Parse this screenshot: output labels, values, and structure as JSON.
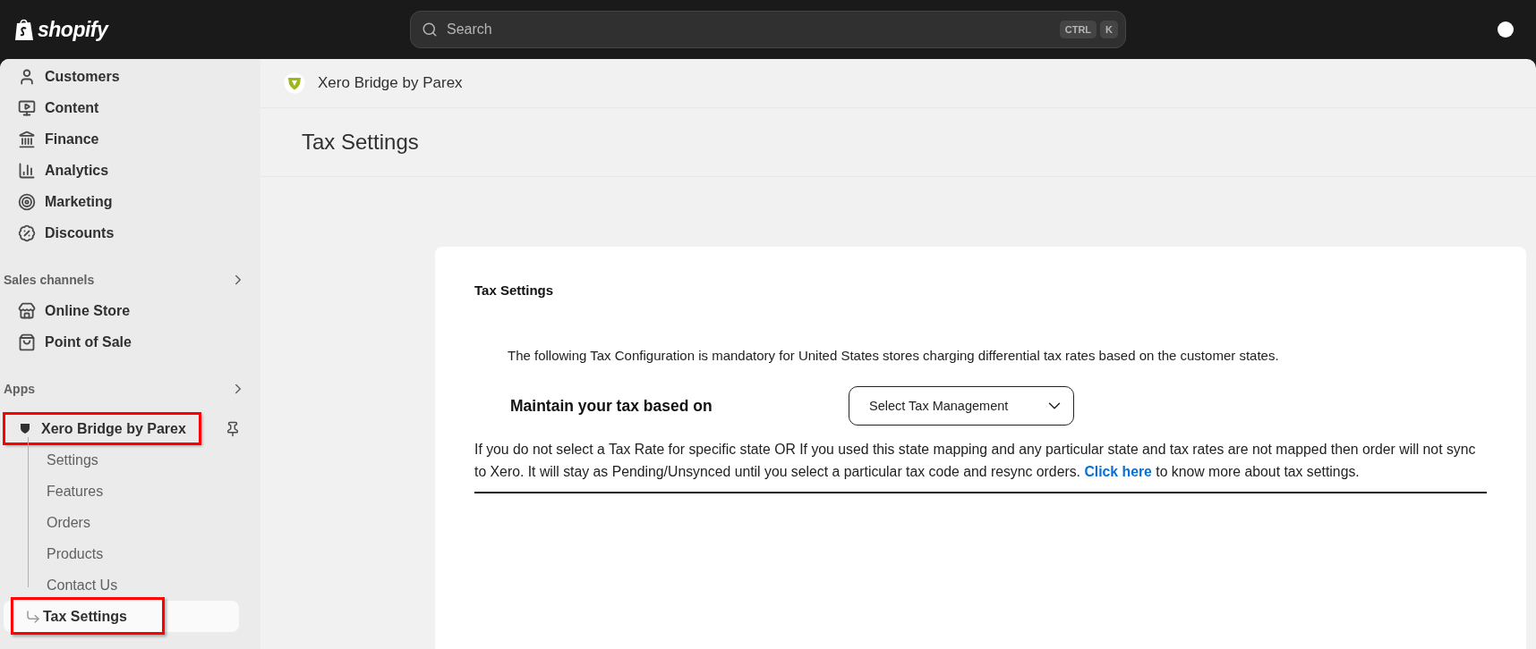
{
  "topbar": {
    "brand": "shopify",
    "search": {
      "placeholder": "Search",
      "keys": [
        "CTRL",
        "K"
      ]
    }
  },
  "sidebar": {
    "main_items": [
      {
        "label": "Customers",
        "kind": "user"
      },
      {
        "label": "Content",
        "kind": "content"
      },
      {
        "label": "Finance",
        "kind": "bank"
      },
      {
        "label": "Analytics",
        "kind": "chart"
      },
      {
        "label": "Marketing",
        "kind": "target"
      },
      {
        "label": "Discounts",
        "kind": "discount"
      }
    ],
    "sections": [
      {
        "title": "Sales channels",
        "items": [
          {
            "label": "Online Store",
            "kind": "store"
          },
          {
            "label": "Point of Sale",
            "kind": "bag"
          }
        ]
      },
      {
        "title": "Apps"
      }
    ],
    "app": {
      "label": "Xero Bridge by Parex",
      "highlighted": true,
      "pinned": false,
      "children": [
        {
          "label": "Settings",
          "selected": false,
          "highlighted": false
        },
        {
          "label": "Features",
          "selected": false,
          "highlighted": false
        },
        {
          "label": "Orders",
          "selected": false,
          "highlighted": false
        },
        {
          "label": "Products",
          "selected": false,
          "highlighted": false
        },
        {
          "label": "Contact Us",
          "selected": false,
          "highlighted": false
        },
        {
          "label": "Tax Settings",
          "selected": true,
          "highlighted": true
        }
      ]
    }
  },
  "app_header": {
    "title": "Xero Bridge by Parex"
  },
  "page_title": "Tax Settings",
  "card": {
    "title": "Tax Settings",
    "intro": "The following Tax Configuration is mandatory for United States stores charging differential tax rates based on the customer states.",
    "field_label": "Maintain your tax based on",
    "select_value": "Select Tax Management",
    "note": {
      "before": "If you do not select a Tax Rate for specific state OR If you used this state mapping and any particular state and tax rates are not mapped then order will not sync to Xero. It will stay as Pending/Unsynced until you select a particular tax code and resync orders. ",
      "link": "Click here",
      "after": " to know more about tax settings."
    }
  }
}
